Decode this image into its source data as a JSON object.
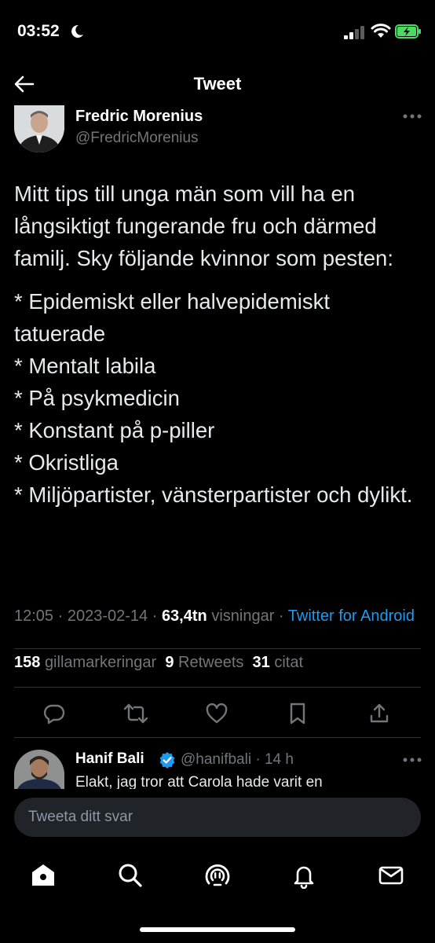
{
  "status_bar": {
    "time": "03:52"
  },
  "header": {
    "title": "Tweet"
  },
  "tweet": {
    "author_name": "Fredric Morenius",
    "author_handle": "@FredricMorenius",
    "paragraph": "Mitt tips till unga män som vill ha en långsiktigt fungerande fru och därmed familj. Sky följande kvinnor som pesten:",
    "list_items": [
      "* Epidemiskt eller halvepidemiskt tatuerade",
      "* Mentalt labila",
      "* På psykmedicin",
      "* Konstant på p-piller",
      "* Okristliga",
      "* Miljöpartister, vänsterpartister och dylikt."
    ],
    "time": "12:05",
    "date": "2023-02-14",
    "views_count": "63,4tn",
    "views_label": "visningar",
    "source": "Twitter for Android",
    "likes_count": "158",
    "likes_label": "gillamarkeringar",
    "retweets_count": "9",
    "retweets_label": "Retweets",
    "quotes_count": "31",
    "quotes_label": "citat"
  },
  "actions": [
    "reply-icon",
    "retweet-icon",
    "like-icon",
    "bookmark-icon",
    "share-icon"
  ],
  "reply": {
    "author_name": "Hanif Bali",
    "author_handle": "@hanifbali",
    "time_ago": "14 h",
    "text": "Elakt, jag tror att Carola hade varit en"
  },
  "compose": {
    "placeholder": "Tweeta ditt svar"
  },
  "bottom_nav": [
    "home-icon",
    "search-icon",
    "spaces-icon",
    "notifications-icon",
    "messages-icon"
  ],
  "colors": {
    "background": "#000000",
    "link": "#1d9bf0",
    "muted": "#71767b",
    "verified": "#1d9bf0"
  }
}
